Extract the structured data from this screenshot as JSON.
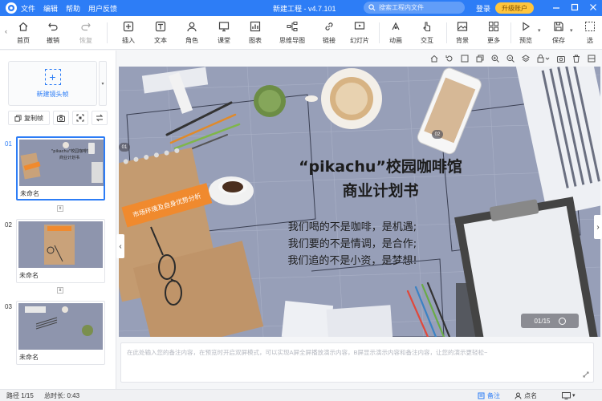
{
  "titlebar": {
    "menu": [
      "文件",
      "编辑",
      "帮助",
      "用户反馈"
    ],
    "window_title": "新建工程 - v4.7.101",
    "search_placeholder": "搜索工程内文件",
    "login": "登录",
    "upgrade": "升级账户",
    "accent": "#2d7df6"
  },
  "toolbar": {
    "home": "首页",
    "undo": "撤销",
    "redo": "恢复",
    "insert": "插入",
    "text": "文本",
    "role": "角色",
    "classroom": "课堂",
    "chart": "图表",
    "mindmap": "思维导图",
    "link": "链接",
    "slideshow": "幻灯片",
    "animation": "动画",
    "interact": "交互",
    "background": "背景",
    "more": "更多",
    "preview": "预览",
    "save": "保存",
    "select": "选"
  },
  "leftpanel": {
    "new_lens": "新建镜头帧",
    "copy_frame": "复制帧",
    "thumbs": [
      {
        "num": "01",
        "name": "未命名"
      },
      {
        "num": "02",
        "name": "未命名"
      },
      {
        "num": "03",
        "name": "未命名"
      }
    ]
  },
  "slide": {
    "title_line1": "“pikachu”校园咖啡馆",
    "title_line2": "商业计划书",
    "body": [
      "我们喝的不是咖啡，是机遇;",
      "我们要的不是情调，是合作;",
      "我们追的不是小资，是梦想!"
    ],
    "tag": "市场环境及自身优势分析",
    "side_badge_left": "01",
    "side_badge_mid": "02",
    "page_indicator": "01/15"
  },
  "notes": {
    "placeholder": "在此处输入您的备注内容，在预览时开启双屏模式，可以实现A屏全屏播放演示内容，B屏显示演示内容和备注内容，让您的演示更轻松~"
  },
  "status": {
    "path": "路径 1/15",
    "duration": "总时长: 0:43",
    "notes": "备注",
    "roll_call": "点名"
  }
}
